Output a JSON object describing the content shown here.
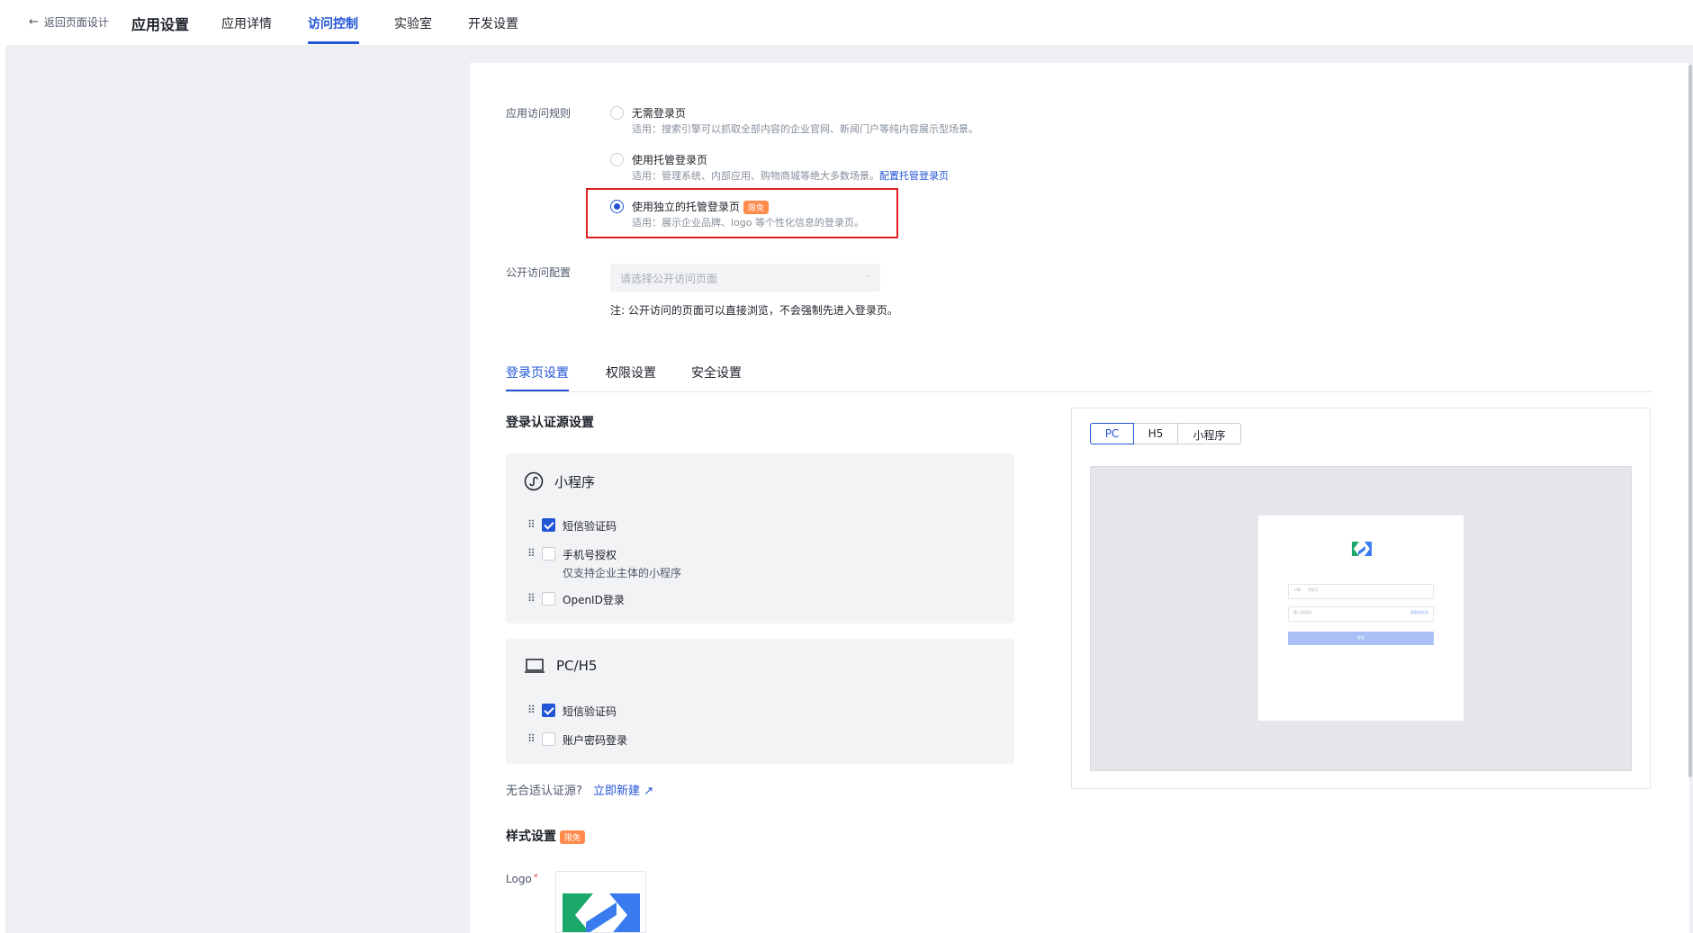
{
  "nav": {
    "back_label": "返回页面设计",
    "app_title": "应用设置",
    "tabs": [
      {
        "label": "应用详情"
      },
      {
        "label": "访问控制"
      },
      {
        "label": "实验室"
      },
      {
        "label": "开发设置"
      }
    ]
  },
  "access_rule": {
    "label": "应用访问规则",
    "options": [
      {
        "title": "无需登录页",
        "desc": "适用：搜索引擎可以抓取全部内容的企业官网、新闻门户等纯内容展示型场景。",
        "selected": false
      },
      {
        "title": "使用托管登录页",
        "desc": "适用：管理系统、内部应用、购物商城等绝大多数场景。",
        "link": "配置托管登录页",
        "selected": false
      },
      {
        "title": "使用独立的托管登录页",
        "badge": "限免",
        "desc": "适用：展示企业品牌、logo 等个性化信息的登录页。",
        "selected": true
      }
    ]
  },
  "public_access": {
    "label": "公开访问配置",
    "placeholder": "请选择公开访问页面",
    "note": "注: 公开访问的页面可以直接浏览，不会强制先进入登录页。"
  },
  "subtabs": [
    {
      "label": "登录页设置"
    },
    {
      "label": "权限设置"
    },
    {
      "label": "安全设置"
    }
  ],
  "auth_source": {
    "title": "登录认证源设置",
    "miniprogram": {
      "title": "小程序",
      "items": [
        {
          "label": "短信验证码",
          "checked": true
        },
        {
          "label": "手机号授权",
          "sub": "仅支持企业主体的小程序",
          "checked": false
        },
        {
          "label": "OpenID登录",
          "checked": false
        }
      ]
    },
    "pc_h5": {
      "title": "PC/H5",
      "items": [
        {
          "label": "短信验证码",
          "checked": true
        },
        {
          "label": "账户密码登录",
          "checked": false
        }
      ]
    },
    "hint": "无合适认证源?",
    "hint_link": "立即新建"
  },
  "preview": {
    "segments": [
      "PC",
      "H5",
      "小程序"
    ],
    "selected": "PC",
    "phone_prefix": "+86",
    "phone_placeholder": "手机号",
    "code_placeholder": "输入验证码",
    "code_button": "获取验证码",
    "login_button": "登录"
  },
  "style_settings": {
    "title": "样式设置",
    "badge": "限免",
    "logo_label": "Logo",
    "required_mark": "*"
  },
  "colors": {
    "accent": "#2255d6",
    "badge": "#ff8a4c",
    "highlight": "#e02020",
    "logo_green": "#1aa96b",
    "logo_blue": "#3a7bf0"
  }
}
